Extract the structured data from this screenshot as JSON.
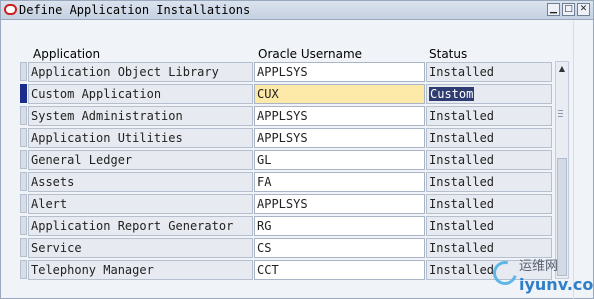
{
  "window": {
    "title": "Define Application Installations",
    "controls": [
      "minimize-icon",
      "maximize-icon",
      "close-icon"
    ]
  },
  "headers": {
    "application": "Application",
    "username": "Oracle Username",
    "status": "Status"
  },
  "rows": [
    {
      "application": "Application Object Library",
      "username": "APPLSYS",
      "status": "Installed"
    },
    {
      "application": "Custom Application",
      "username": "CUX",
      "status": "Custom",
      "active": true
    },
    {
      "application": "System Administration",
      "username": "APPLSYS",
      "status": "Installed"
    },
    {
      "application": "Application Utilities",
      "username": "APPLSYS",
      "status": "Installed"
    },
    {
      "application": "General Ledger",
      "username": "GL",
      "status": "Installed"
    },
    {
      "application": "Assets",
      "username": "FA",
      "status": "Installed"
    },
    {
      "application": "Alert",
      "username": "APPLSYS",
      "status": "Installed"
    },
    {
      "application": "Application Report Generator",
      "username": "RG",
      "status": "Installed"
    },
    {
      "application": "Service",
      "username": "CS",
      "status": "Installed"
    },
    {
      "application": "Telephony Manager",
      "username": "CCT",
      "status": "Installed"
    }
  ],
  "watermark": {
    "line1": "运维网",
    "line2": "iyunv.com"
  },
  "colors": {
    "active_field": "#fde9a8",
    "selection": "#2f3c72",
    "row_marker_active": "#1a2d8a",
    "app_icon": "#cc1f1f"
  }
}
